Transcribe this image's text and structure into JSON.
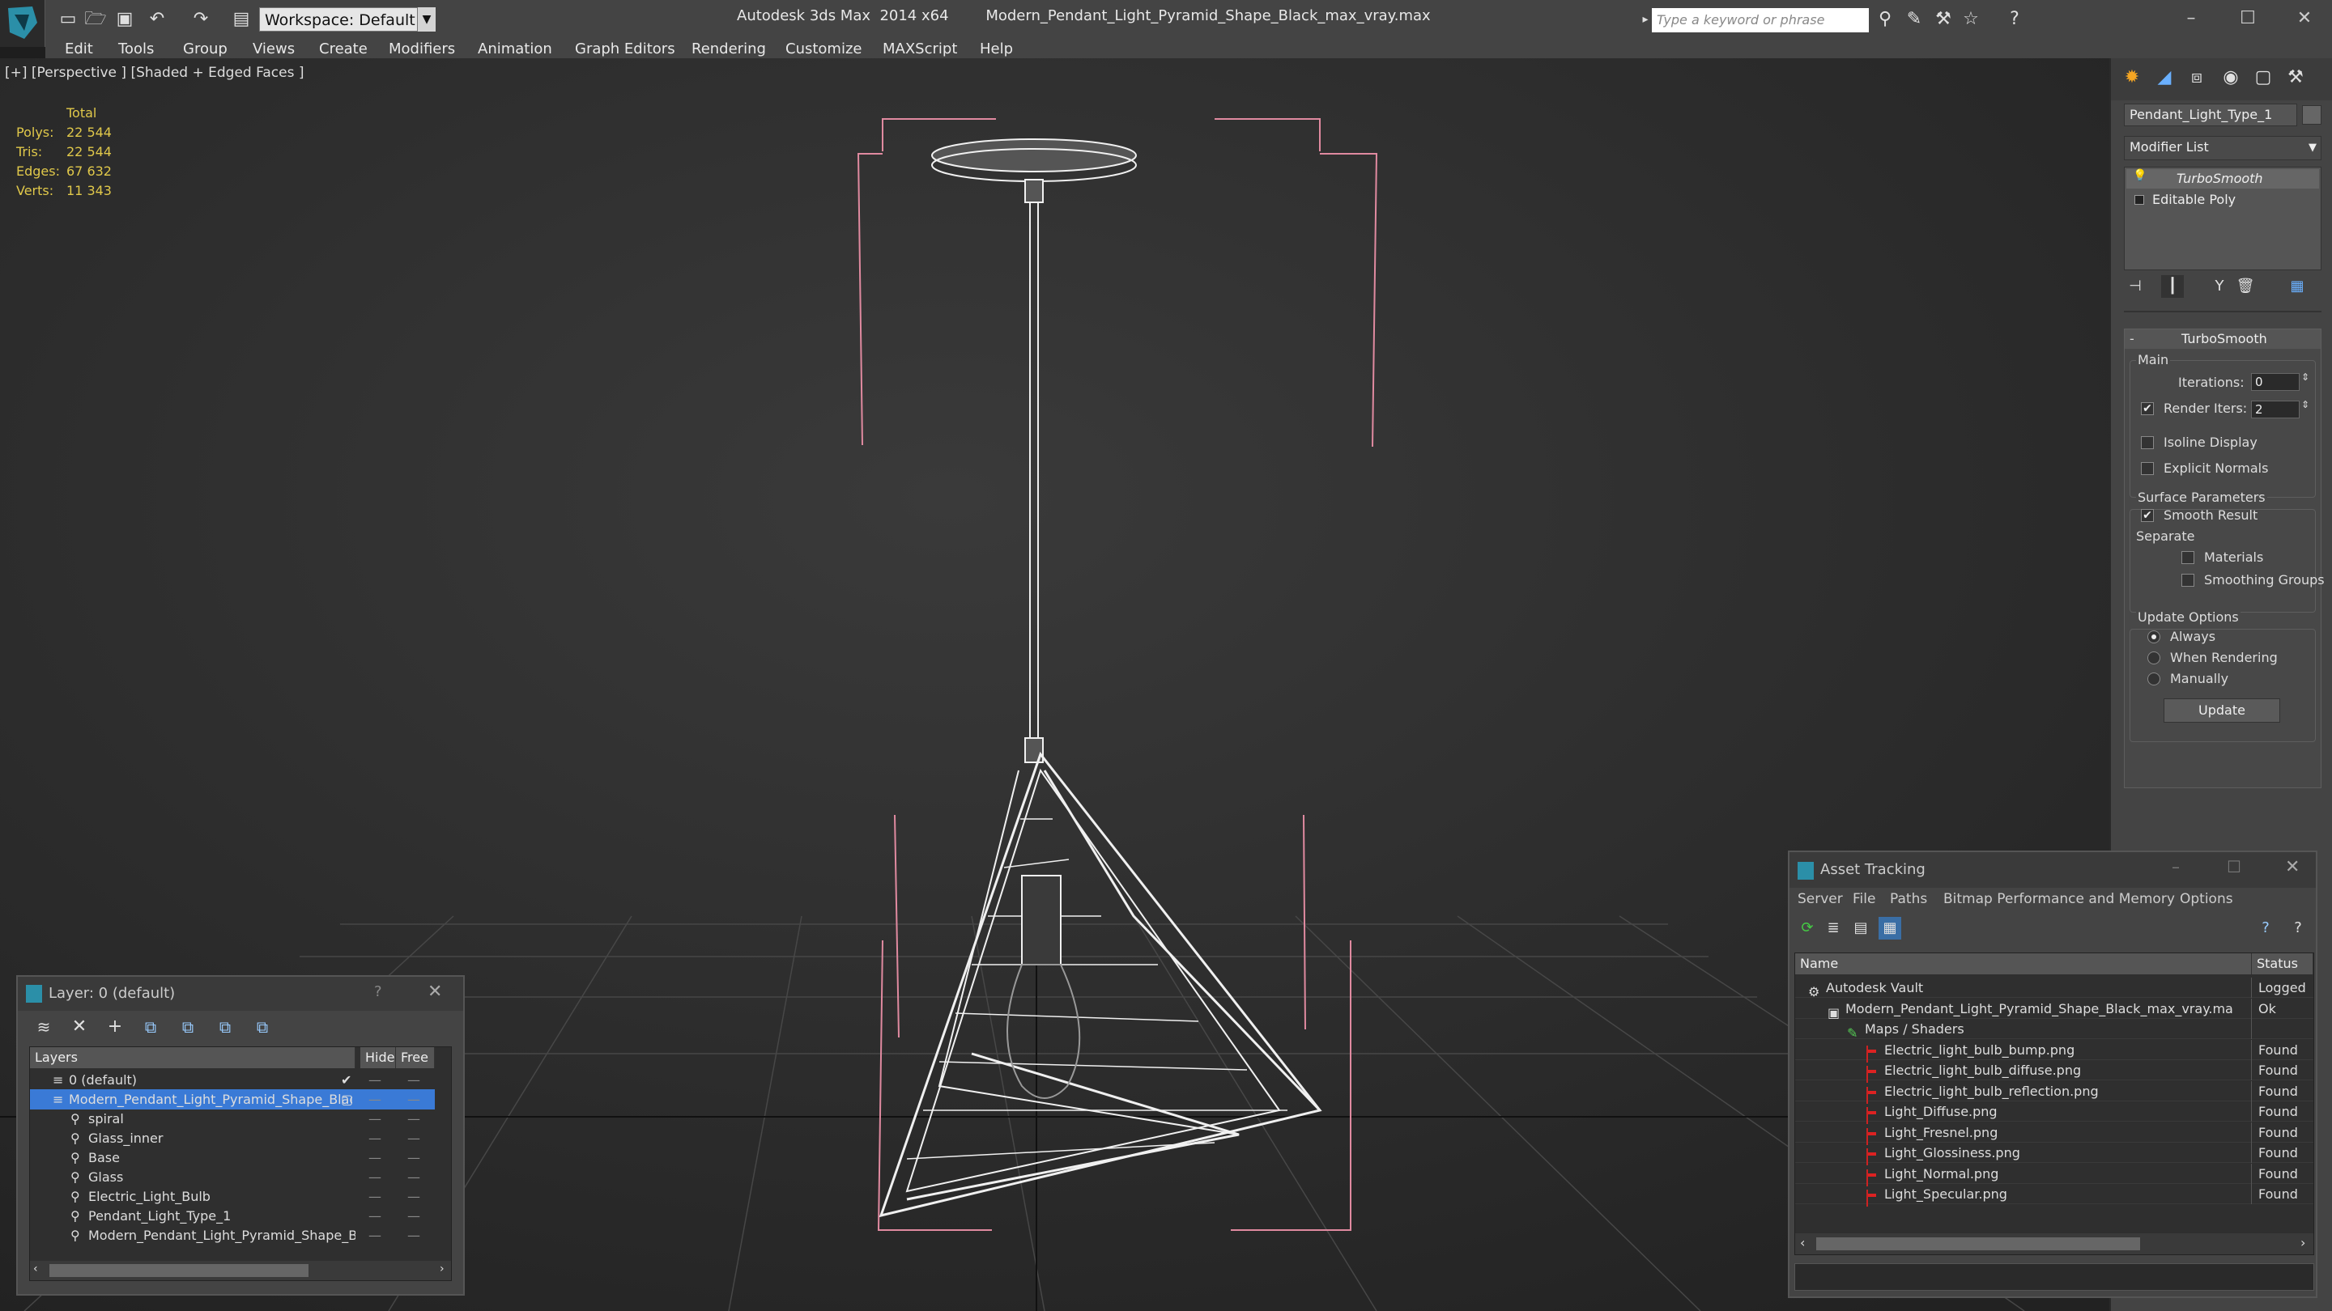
{
  "app": {
    "title": "Autodesk 3ds Max  2014 x64",
    "file": "Modern_Pendant_Light_Pyramid_Shape_Black_max_vray.max",
    "workspace": "Workspace: Default",
    "search_placeholder": "Type a keyword or phrase"
  },
  "menu": [
    "Edit",
    "Tools",
    "Group",
    "Views",
    "Create",
    "Modifiers",
    "Animation",
    "Graph Editors",
    "Rendering",
    "Customize",
    "MAXScript",
    "Help"
  ],
  "viewport": {
    "label": "[+] [Perspective ] [Shaded + Edged Faces ]",
    "stats_header": "Total",
    "stats": [
      {
        "label": "Polys:",
        "value": "22 544"
      },
      {
        "label": "Tris:",
        "value": "22 544"
      },
      {
        "label": "Edges:",
        "value": "67 632"
      },
      {
        "label": "Verts:",
        "value": "11 343"
      }
    ]
  },
  "command_panel": {
    "object_name": "Pendant_Light_Type_1",
    "modifier_list": "Modifier List",
    "stack": [
      "TurboSmooth",
      "Editable Poly"
    ],
    "rollout": "TurboSmooth",
    "main_label": "Main",
    "iterations_label": "Iterations:",
    "iterations": "0",
    "render_iters_label": "Render Iters:",
    "render_iters": "2",
    "isoline": "Isoline Display",
    "explicit": "Explicit Normals",
    "surface_label": "Surface Parameters",
    "smooth_result": "Smooth Result",
    "separate": "Separate",
    "materials": "Materials",
    "smoothing_groups": "Smoothing Groups",
    "update_options": "Update Options",
    "always": "Always",
    "when_rendering": "When Rendering",
    "manually": "Manually",
    "update_btn": "Update"
  },
  "layers": {
    "title": "Layer: 0 (default)",
    "help": "?",
    "col_layers": "Layers",
    "col_hide": "Hide",
    "col_free": "Free",
    "rows": [
      {
        "name": "0 (default)",
        "indent": 1
      },
      {
        "name": "Modern_Pendant_Light_Pyramid_Shape_Black",
        "indent": 1,
        "selected": true
      },
      {
        "name": "spiral",
        "indent": 2
      },
      {
        "name": "Glass_inner",
        "indent": 2
      },
      {
        "name": "Base",
        "indent": 2
      },
      {
        "name": "Glass",
        "indent": 2
      },
      {
        "name": "Electric_Light_Bulb",
        "indent": 2
      },
      {
        "name": "Pendant_Light_Type_1",
        "indent": 2
      },
      {
        "name": "Modern_Pendant_Light_Pyramid_Shape_Black",
        "indent": 2
      }
    ]
  },
  "assets": {
    "title": "Asset Tracking",
    "menu": [
      "Server",
      "File",
      "Paths",
      "Bitmap Performance and Memory",
      "Options"
    ],
    "col_name": "Name",
    "col_status": "Status",
    "rows": [
      {
        "name": "Autodesk Vault",
        "status": "Logged",
        "indent": 0
      },
      {
        "name": "Modern_Pendant_Light_Pyramid_Shape_Black_max_vray.max",
        "status": "Ok",
        "indent": 1
      },
      {
        "name": "Maps / Shaders",
        "status": "",
        "indent": 2
      },
      {
        "name": "Electric_light_bulb_bump.png",
        "status": "Found",
        "indent": 3
      },
      {
        "name": "Electric_light_bulb_diffuse.png",
        "status": "Found",
        "indent": 3
      },
      {
        "name": "Electric_light_bulb_reflection.png",
        "status": "Found",
        "indent": 3
      },
      {
        "name": "Light_Diffuse.png",
        "status": "Found",
        "indent": 3
      },
      {
        "name": "Light_Fresnel.png",
        "status": "Found",
        "indent": 3
      },
      {
        "name": "Light_Glossiness.png",
        "status": "Found",
        "indent": 3
      },
      {
        "name": "Light_Normal.png",
        "status": "Found",
        "indent": 3
      },
      {
        "name": "Light_Specular.png",
        "status": "Found",
        "indent": 3
      }
    ]
  }
}
